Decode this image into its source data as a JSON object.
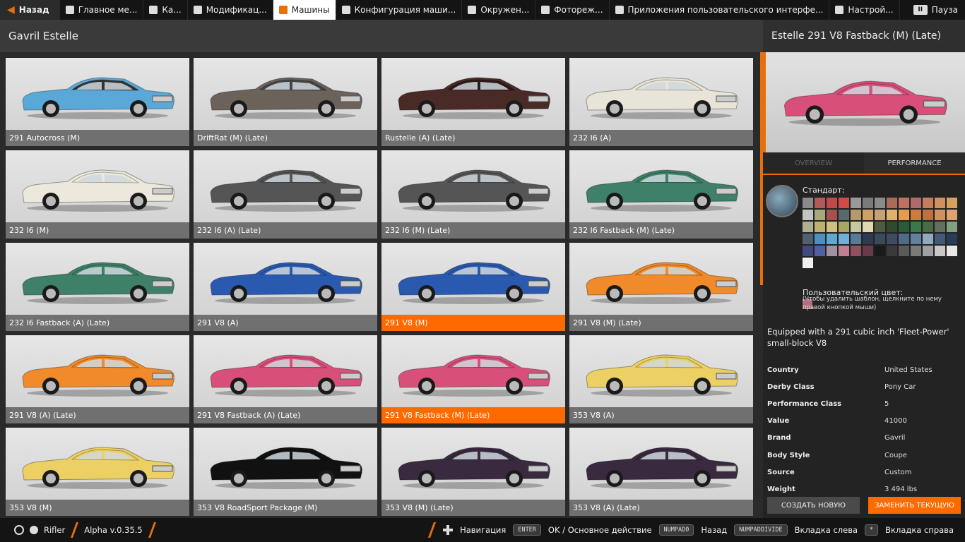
{
  "topbar": {
    "back": "Назад",
    "tabs": [
      {
        "label": "Главное ме...",
        "icon": "home-icon"
      },
      {
        "label": "Ка...",
        "icon": "map-icon"
      },
      {
        "label": "Модификац...",
        "icon": "puzzle-icon"
      },
      {
        "label": "Машины",
        "icon": "car-icon",
        "active": true
      },
      {
        "label": "Конфигурация маши...",
        "icon": "engine-icon"
      },
      {
        "label": "Окружен...",
        "icon": "weather-icon"
      },
      {
        "label": "Фотореж...",
        "icon": "camera-icon"
      },
      {
        "label": "Приложения пользовательского интерфе...",
        "icon": "apps-icon"
      },
      {
        "label": "Настрой...",
        "icon": "settings-icon"
      }
    ],
    "pause": "Пауза",
    "pause_key": "II"
  },
  "left": {
    "title": "Gavril Estelle"
  },
  "cards": [
    {
      "label": "291 Autocross (M)",
      "color": "#5aa8d8",
      "roof": "#333333"
    },
    {
      "label": "DriftRat (M) (Late)",
      "color": "#6b625a",
      "roof": "#444444"
    },
    {
      "label": "Rustelle (A) (Late)",
      "color": "#4a2a26",
      "roof": "#2a1a18"
    },
    {
      "label": "232 I6 (A)",
      "color": "#e8e4d8",
      "roof": "#e8e4d8"
    },
    {
      "label": "232 I6 (M)",
      "color": "#ece8dc",
      "roof": "#ece8dc"
    },
    {
      "label": "232 I6 (A) (Late)",
      "color": "#555555",
      "roof": "#555555"
    },
    {
      "label": "232 I6 (M) (Late)",
      "color": "#555555",
      "roof": "#555555"
    },
    {
      "label": "232 I6 Fastback (M) (Late)",
      "color": "#3e8068",
      "roof": "#3e8068"
    },
    {
      "label": "232 I6 Fastback (A) (Late)",
      "color": "#3e8068",
      "roof": "#3e8068"
    },
    {
      "label": "291 V8 (A)",
      "color": "#2a5ab0",
      "roof": "#2a5ab0"
    },
    {
      "label": "291 V8 (M)",
      "color": "#2a5ab0",
      "roof": "#2a5ab0",
      "selected": true
    },
    {
      "label": "291 V8 (M) (Late)",
      "color": "#f08a2a",
      "roof": "#f08a2a"
    },
    {
      "label": "291 V8 (A) (Late)",
      "color": "#f08a2a",
      "roof": "#f08a2a"
    },
    {
      "label": "291 V8 Fastback (A) (Late)",
      "color": "#d8507a",
      "roof": "#d8507a"
    },
    {
      "label": "291 V8 Fastback (M) (Late)",
      "color": "#d8507a",
      "roof": "#d8507a",
      "selected": true
    },
    {
      "label": "353 V8 (A)",
      "color": "#ecd064",
      "roof": "#ecd064"
    },
    {
      "label": "353 V8 (M)",
      "color": "#ecd064",
      "roof": "#ecd064"
    },
    {
      "label": "353 V8 RoadSport Package (M)",
      "color": "#111111",
      "roof": "#111111"
    },
    {
      "label": "353 V8 (M) (Late)",
      "color": "#3a2a40",
      "roof": "#3a2a40"
    },
    {
      "label": "353 V8 (A) (Late)",
      "color": "#3a2a40",
      "roof": "#3a2a40"
    }
  ],
  "detail": {
    "title": "Estelle 291 V8 Fastback (M) (Late)",
    "preview_color": "#d8507a",
    "tabs": [
      "OVERVIEW",
      "PERFORMANCE"
    ],
    "paint_label": "Стандарт:",
    "custom_label": "Пользовательский цвет:",
    "custom_hint": "(Чтобы удалить шаблон, щелкните по нему правой кнопкой мыши)",
    "description": "Equipped with a 291 cubic inch 'Fleet-Power' small-block V8",
    "stats": [
      {
        "key": "Country",
        "value": "United States"
      },
      {
        "key": "Derby Class",
        "value": "Pony Car"
      },
      {
        "key": "Performance Class",
        "value": "5"
      },
      {
        "key": "Value",
        "value": "41000"
      },
      {
        "key": "Brand",
        "value": "Gavril"
      },
      {
        "key": "Body Style",
        "value": "Coupe"
      },
      {
        "key": "Source",
        "value": "Custom"
      },
      {
        "key": "Weight",
        "value": "3 494 lbs"
      }
    ],
    "btn_new": "СОЗДАТЬ НОВУЮ",
    "btn_replace": "ЗАМЕНИТЬ ТЕКУЩУЮ",
    "swatches": [
      "#8a8a8a",
      "#b05a5a",
      "#c04848",
      "#d04a4a",
      "#9a9a9a",
      "#7a7a7a",
      "#8a8a8a",
      "#aa6a5a",
      "#c07060",
      "#b06a6a",
      "#c47e5e",
      "#d09060",
      "#d8a060",
      "#c4c4c4",
      "#a8a878",
      "#a85050",
      "#5a6a6a",
      "#b89a6a",
      "#d0a068",
      "#c8a078",
      "#e0b070",
      "#e89a50",
      "#d07a40",
      "#c07040",
      "#d09060",
      "#e0a070",
      "#b0b090",
      "#c0b070",
      "#d0c080",
      "#a8a860",
      "#c8c8a0",
      "#e0d8b0",
      "#505a40",
      "#304a30",
      "#2a5a3a",
      "#3a7a4a",
      "#4a6a4a",
      "#607060",
      "#80a080",
      "#506070",
      "#4a90c0",
      "#60a8d0",
      "#70b0d8",
      "#5a7a9a",
      "#303a50",
      "#3a4a5a",
      "#404a60",
      "#506a8a",
      "#6080a0",
      "#90a8c0",
      "#405a78",
      "#2a3a5a",
      "#404a80",
      "#5060a0",
      "#a090a0",
      "#c08090",
      "#905060",
      "#6a3a4a",
      "#1a1a1a",
      "#3a3a3a",
      "#5a5a5a",
      "#7a7a7a",
      "#a0a0a0",
      "#c8c8c8",
      "#e8e8e8",
      "#f0f0f0"
    ]
  },
  "bottombar": {
    "user": "Rifler",
    "version": "Alpha v.0.35.5",
    "hints": [
      {
        "label": "Навигация",
        "key": ""
      },
      {
        "label": "OK / Основное действие",
        "key": "ENTER"
      },
      {
        "label": "Назад",
        "key": "NUMPAD0"
      },
      {
        "label": "Вкладка слева",
        "key": "NUMPADDIVIDE"
      },
      {
        "label": "Вкладка справа",
        "key": "*"
      }
    ]
  }
}
